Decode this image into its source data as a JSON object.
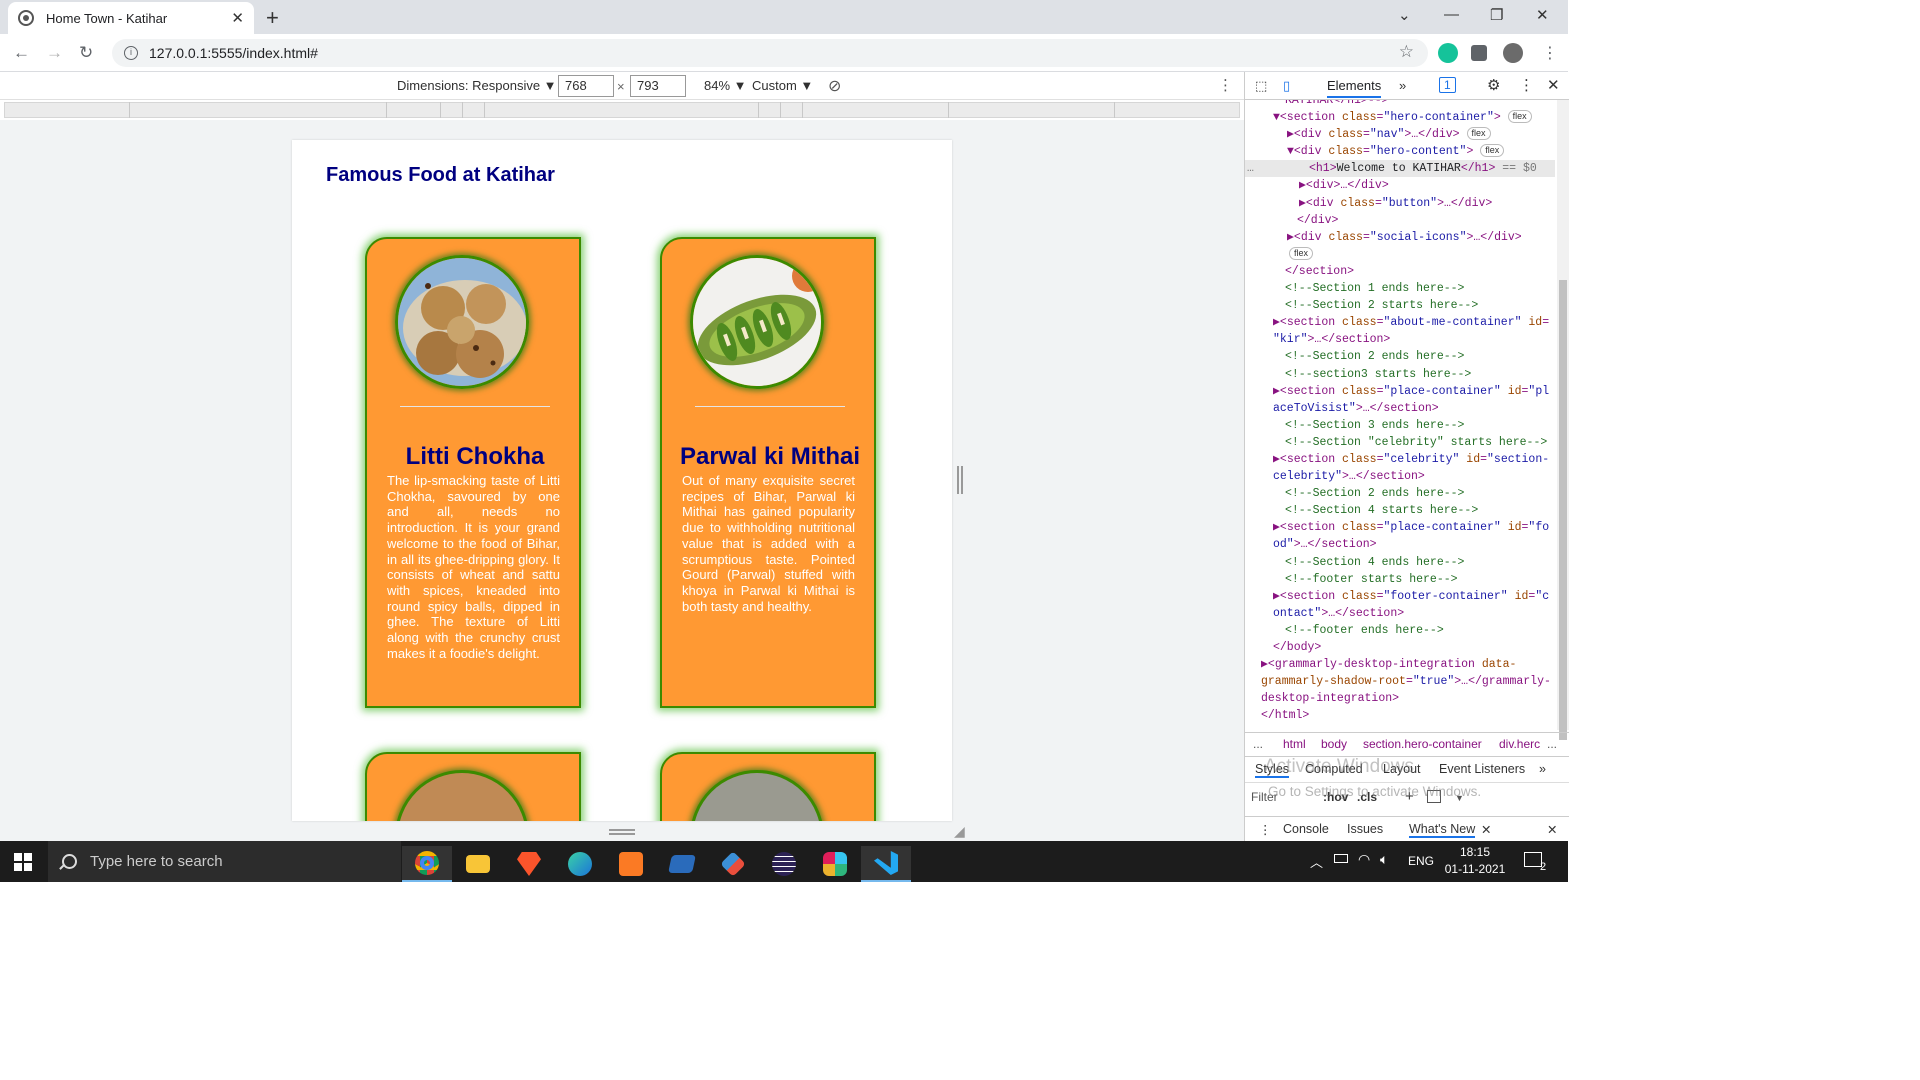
{
  "browser": {
    "tab_title": "Home Town - Katihar",
    "url": "127.0.0.1:5555/index.html#"
  },
  "device_toolbar": {
    "dimensions_label": "Dimensions: Responsive ▼",
    "width": "768",
    "height": "793",
    "times": "×",
    "zoom": "84% ▼",
    "throttle": "Custom ▼"
  },
  "page": {
    "section_title": "Famous Food at Katihar",
    "cards": [
      {
        "title": "Litti Chokha",
        "text": "The lip-smacking taste of Litti Chokha, savoured by one and all, needs no introduction. It is your grand welcome to the food of Bihar, in all its ghee-dripping glory. It consists of wheat and sattu with spices, kneaded into round spicy balls, dipped in ghee. The texture of Litti along with the crunchy crust makes it a foodie's delight."
      },
      {
        "title": "Parwal ki Mithai",
        "text": "Out of many exquisite secret recipes of Bihar, Parwal ki Mithai has gained popularity due to withholding nutritional value that is added with a scrumptious taste. Pointed Gourd (Parwal) stuffed with khoya in Parwal ki Mithai is both tasty and healthy."
      }
    ]
  },
  "devtools": {
    "tabs": {
      "elements": "Elements",
      "issues_badge": "1"
    },
    "crumbs": [
      "...",
      "html",
      "body",
      "section.hero-container",
      "div.herc",
      "..."
    ],
    "styles_tabs": [
      "Styles",
      "Computed",
      "Layout",
      "Event Listeners"
    ],
    "filter_placeholder": "Filter",
    "filter_tools": [
      ":hov",
      ".cls",
      "+"
    ],
    "drawer_tabs": [
      "Console",
      "Issues",
      "What's New"
    ],
    "watermark_title": "Activate Windows",
    "watermark_sub": "Go to Settings to activate Windows."
  },
  "taskbar": {
    "search_placeholder": "Type here to search",
    "lang": "ENG",
    "time": "18:15",
    "date": "01-11-2021",
    "notifications": "2"
  }
}
